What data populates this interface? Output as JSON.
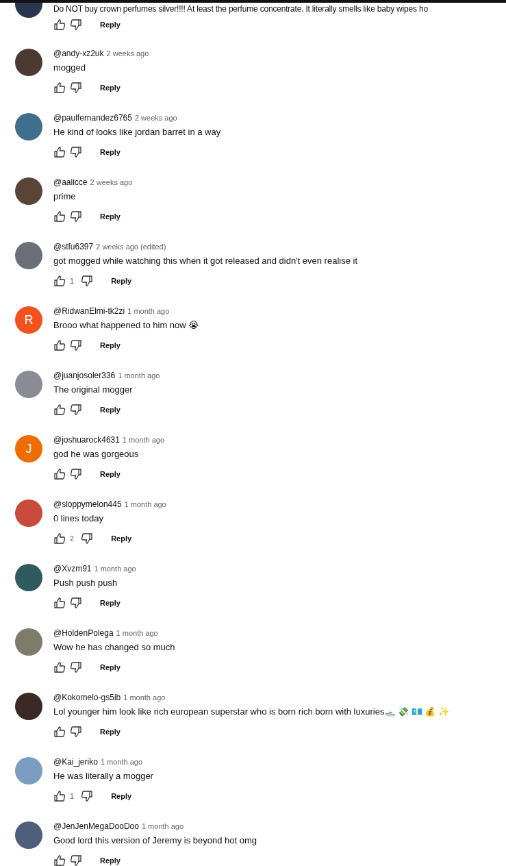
{
  "partial_comment": {
    "text": "Do NOT buy crown perfumes silver!!!! At least the perfume concentrate. It literally smells like baby wipes ho",
    "reply": "Reply"
  },
  "comments": [
    {
      "user": "@andy-xz2uk",
      "time": "2 weeks ago",
      "text": "mogged",
      "reply": "Reply",
      "avatar": {
        "kind": "photo",
        "color": "#4a3a32"
      }
    },
    {
      "user": "@paulfernandez6765",
      "time": "2 weeks ago",
      "text": "He kind of looks like jordan barret in a way",
      "reply": "Reply",
      "avatar": {
        "kind": "photo",
        "color": "#3f6f8c"
      }
    },
    {
      "user": "@aalicce",
      "time": "2 weeks ago",
      "text": "prime",
      "reply": "Reply",
      "avatar": {
        "kind": "photo",
        "color": "#5a4438"
      }
    },
    {
      "user": "@stfu6397",
      "time": "2 weeks ago (edited)",
      "text": "got mogged while watching this when it got released and didn't even realise it",
      "likes": "1",
      "reply": "Reply",
      "avatar": {
        "kind": "photo",
        "color": "#6a6f78"
      }
    },
    {
      "user": "@RidwanElmi-tk2zi",
      "time": "1 month ago",
      "text": "Brooo what happened to him now 😭",
      "reply": "Reply",
      "avatar": {
        "kind": "letter",
        "letter": "R",
        "color": "#f4511e"
      }
    },
    {
      "user": "@juanjosoler336",
      "time": "1 month ago",
      "text": "The original mogger",
      "reply": "Reply",
      "avatar": {
        "kind": "photo",
        "color": "#8a8c94"
      }
    },
    {
      "user": "@joshuarock4631",
      "time": "1 month ago",
      "text": "god he was gorgeous",
      "reply": "Reply",
      "avatar": {
        "kind": "letter",
        "letter": "J",
        "color": "#ef6c00"
      }
    },
    {
      "user": "@sloppymelon445",
      "time": "1 month ago",
      "text": "0 lines today",
      "likes": "2",
      "reply": "Reply",
      "avatar": {
        "kind": "photo",
        "color": "#c94a3a"
      }
    },
    {
      "user": "@Xvzm91",
      "time": "1 month ago",
      "text": "Push push push",
      "reply": "Reply",
      "avatar": {
        "kind": "photo",
        "color": "#2f5a5e"
      }
    },
    {
      "user": "@HoldenPolega",
      "time": "1 month ago",
      "text": "Wow he has changed so much",
      "reply": "Reply",
      "avatar": {
        "kind": "photo",
        "color": "#7d7c6a"
      }
    },
    {
      "user": "@Kokomelo-gs5ib",
      "time": "1 month ago",
      "text": "Lol younger him look like rich european superstar who is born rich born with luxuries🛥️ 💸 💶 💰 ✨",
      "reply": "Reply",
      "avatar": {
        "kind": "photo",
        "color": "#3a2a26"
      }
    },
    {
      "user": "@Kai_jeriko",
      "time": "1 month ago",
      "text": "He was literally a mogger",
      "likes": "1",
      "reply": "Reply",
      "avatar": {
        "kind": "photo",
        "color": "#7a9cc0"
      }
    },
    {
      "user": "@JenJenMegaDooDoo",
      "time": "1 month ago",
      "text": "Good lord this version of Jeremy is beyond hot omg",
      "reply": "Reply",
      "avatar": {
        "kind": "photo",
        "color": "#4d5f7a"
      }
    }
  ]
}
